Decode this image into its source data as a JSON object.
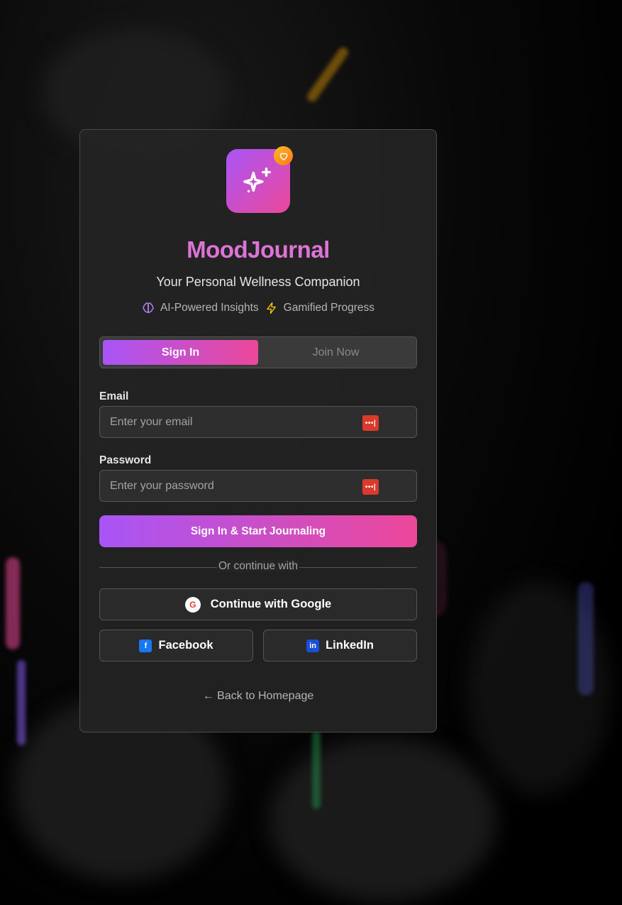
{
  "app": {
    "title": "MoodJournal",
    "subtitle": "Your Personal Wellness Companion",
    "features": [
      {
        "icon": "brain-icon",
        "label": "AI-Powered Insights",
        "color": "#c084fc"
      },
      {
        "icon": "lightning-icon",
        "label": "Gamified Progress",
        "color": "#facc15"
      }
    ]
  },
  "tabs": [
    {
      "label": "Sign In",
      "active": true
    },
    {
      "label": "Join Now",
      "active": false
    }
  ],
  "form": {
    "email": {
      "label": "Email",
      "placeholder": "Enter your email"
    },
    "password": {
      "label": "Password",
      "placeholder": "Enter your password"
    },
    "password_manager_icon": "•••|",
    "submit_label": "Sign In & Start Journaling"
  },
  "social": {
    "divider_text": "Or continue with",
    "google": {
      "label": "Continue with Google",
      "glyph": "G"
    },
    "facebook": {
      "label": "Facebook",
      "glyph": "f",
      "color": "#1877f2"
    },
    "linkedin": {
      "label": "LinkedIn",
      "glyph": "in",
      "color": "#1d4ed8"
    }
  },
  "back_link": "← Back to Homepage",
  "colors": {
    "accent_start": "#a855f7",
    "accent_end": "#ec4899",
    "badge": "#f97316"
  }
}
